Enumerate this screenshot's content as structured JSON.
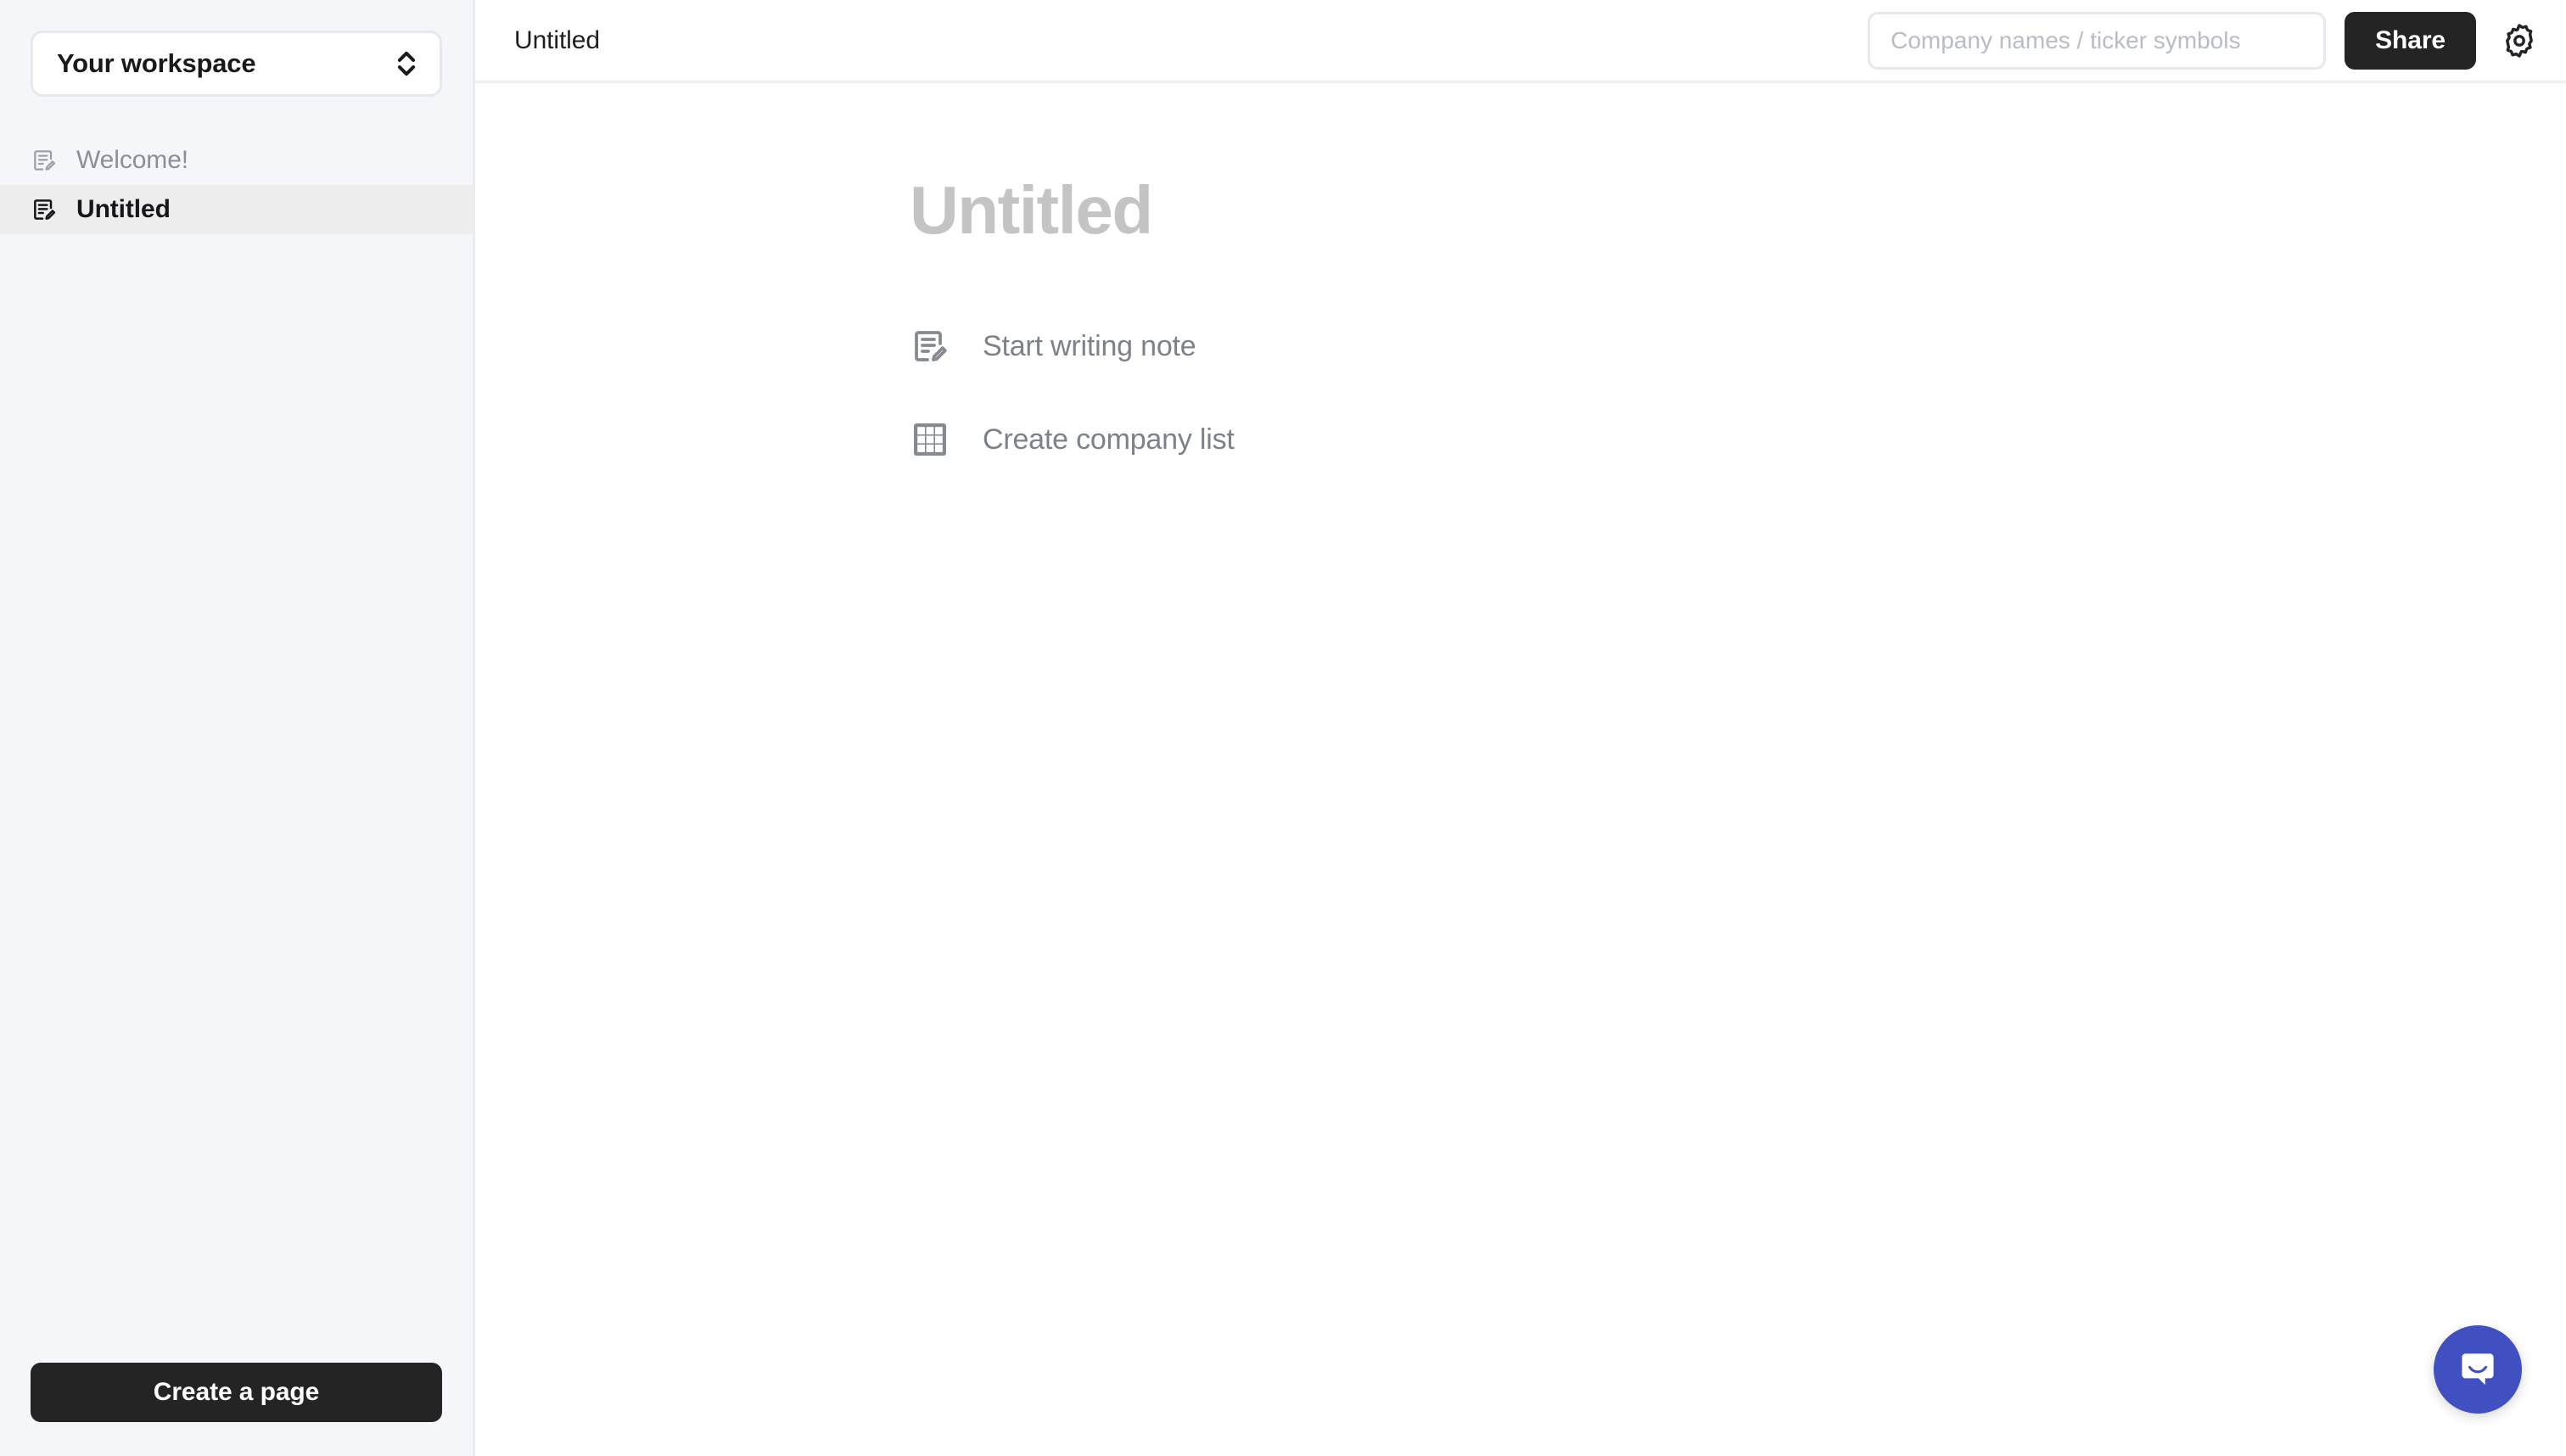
{
  "sidebar": {
    "workspace": {
      "name": "Your workspace",
      "switcher_icon": "chevron-up-down-icon"
    },
    "items": [
      {
        "label": "Welcome!",
        "icon": "note-pencil-icon",
        "active": false
      },
      {
        "label": "Untitled",
        "icon": "note-pencil-icon",
        "active": true
      }
    ],
    "footer": {
      "create_page_label": "Create a page"
    }
  },
  "topbar": {
    "document_title": "Untitled",
    "search": {
      "value": "",
      "placeholder": "Company names / ticker symbols",
      "icon": "search-input"
    },
    "share_label": "Share",
    "settings_icon": "gear-icon"
  },
  "page": {
    "title_placeholder": "Untitled",
    "actions": [
      {
        "label": "Start writing note",
        "icon": "note-pencil-icon"
      },
      {
        "label": "Create company list",
        "icon": "grid-table-icon"
      }
    ]
  },
  "chat": {
    "launcher_icon": "chat-bubble-icon",
    "accent_color": "#4050c0"
  },
  "colors": {
    "sidebar_bg": "#f4f6fa",
    "active_item_bg": "#ededed",
    "button_dark": "#242424",
    "muted_text": "#8b8f98",
    "placeholder_text": "#c4c4c4"
  }
}
